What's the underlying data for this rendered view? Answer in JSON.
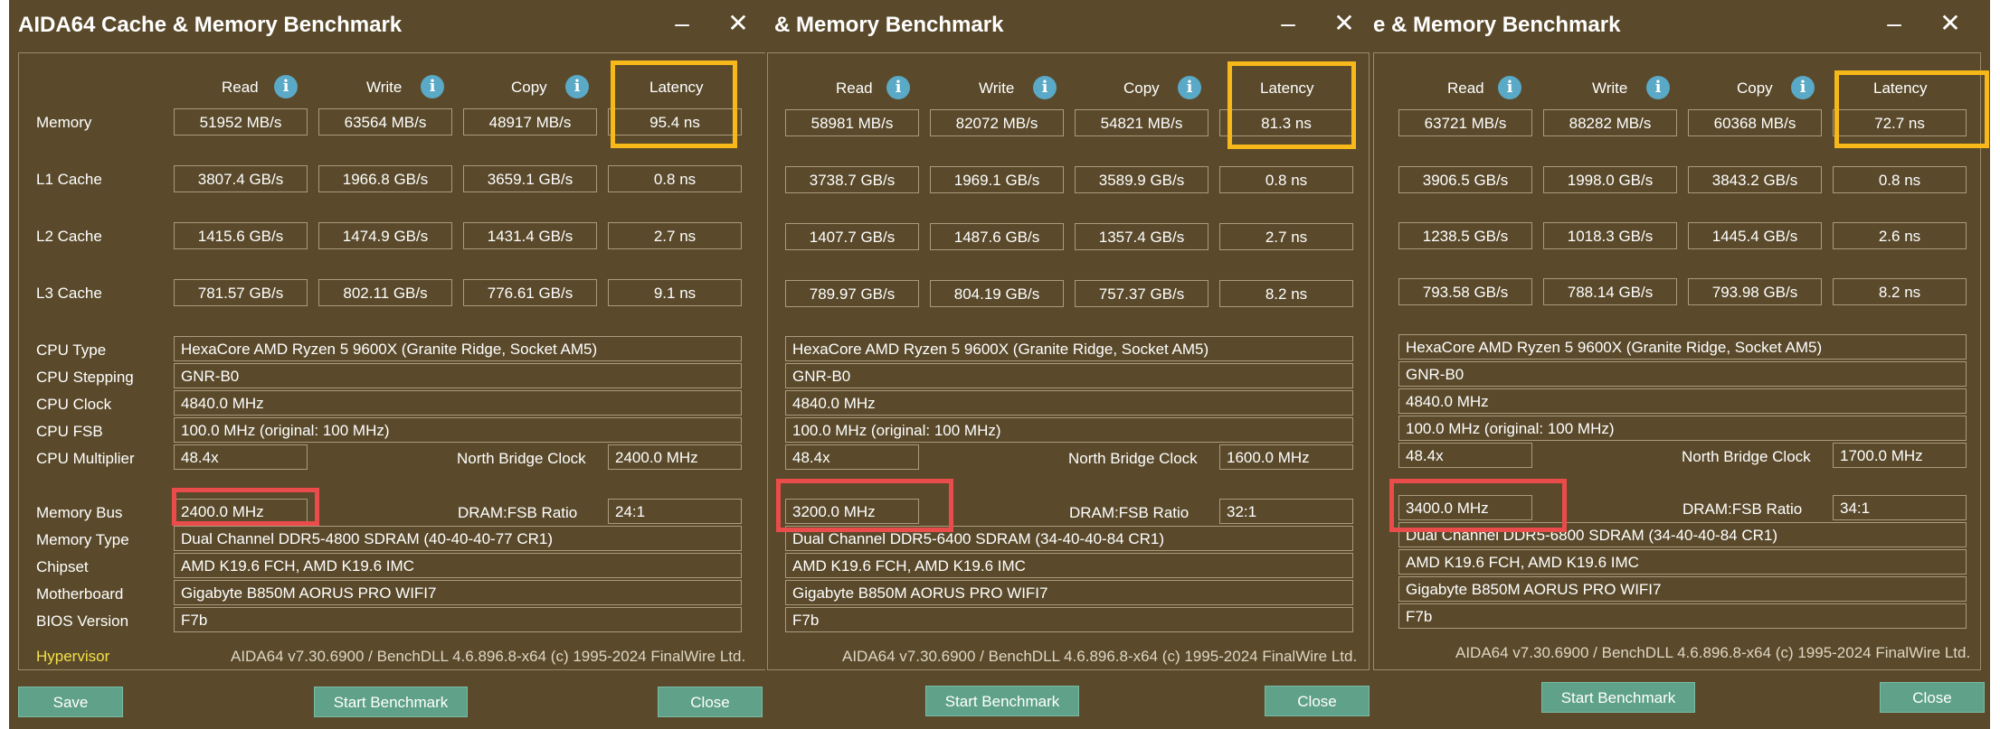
{
  "headers": {
    "read": "Read",
    "write": "Write",
    "copy": "Copy",
    "latency": "Latency"
  },
  "row_labels": {
    "memory": "Memory",
    "l1": "L1 Cache",
    "l2": "L2 Cache",
    "l3": "L3 Cache"
  },
  "info_labels": {
    "cpu_type": "CPU Type",
    "cpu_stepping": "CPU Stepping",
    "cpu_clock": "CPU Clock",
    "cpu_fsb": "CPU FSB",
    "cpu_multiplier": "CPU Multiplier",
    "nb_clock": "North Bridge Clock",
    "memory_bus": "Memory Bus",
    "dram_fsb": "DRAM:FSB Ratio",
    "memory_type": "Memory Type",
    "chipset": "Chipset",
    "motherboard": "Motherboard",
    "bios": "BIOS Version"
  },
  "buttons": {
    "save": "Save",
    "start": "Start Benchmark",
    "close": "Close"
  },
  "hypervisor": "Hypervisor",
  "footer": "AIDA64 v7.30.6900 / BenchDLL 4.6.896.8-x64  (c) 1995-2024 FinalWire Ltd.",
  "icons": {
    "info": "info-icon",
    "minimize": "minimize-icon",
    "close": "close-icon"
  },
  "colors": {
    "background": "#5a4a2b",
    "highlight_latency": "#f7b919",
    "highlight_bus": "#ea4b4b",
    "buttons": "#5fa189",
    "hypervisor": "#f3e04a"
  },
  "windows": [
    {
      "title": "AIDA64 Cache & Memory Benchmark",
      "memory": [
        "51952 MB/s",
        "63564 MB/s",
        "48917 MB/s",
        "95.4 ns"
      ],
      "l1": [
        "3807.4 GB/s",
        "1966.8 GB/s",
        "3659.1 GB/s",
        "0.8 ns"
      ],
      "l2": [
        "1415.6 GB/s",
        "1474.9 GB/s",
        "1431.4 GB/s",
        "2.7 ns"
      ],
      "l3": [
        "781.57 GB/s",
        "802.11 GB/s",
        "776.61 GB/s",
        "9.1 ns"
      ],
      "cpu_type": "HexaCore AMD Ryzen 5 9600X  (Granite Ridge, Socket AM5)",
      "cpu_stepping": "GNR-B0",
      "cpu_clock": "4840.0 MHz",
      "cpu_fsb": "100.0 MHz  (original: 100 MHz)",
      "cpu_multiplier": "48.4x",
      "nb_clock": "2400.0 MHz",
      "memory_bus": "2400.0 MHz",
      "dram_fsb": "24:1",
      "memory_type": "Dual Channel DDR5-4800 SDRAM  (40-40-40-77 CR1)",
      "chipset": "AMD K19.6 FCH, AMD K19.6 IMC",
      "motherboard": "Gigabyte B850M AORUS PRO WIFI7",
      "bios": "F7b"
    },
    {
      "title": "& Memory Benchmark",
      "memory": [
        "58981 MB/s",
        "82072 MB/s",
        "54821 MB/s",
        "81.3 ns"
      ],
      "l1": [
        "3738.7 GB/s",
        "1969.1 GB/s",
        "3589.9 GB/s",
        "0.8 ns"
      ],
      "l2": [
        "1407.7 GB/s",
        "1487.6 GB/s",
        "1357.4 GB/s",
        "2.7 ns"
      ],
      "l3": [
        "789.97 GB/s",
        "804.19 GB/s",
        "757.37 GB/s",
        "8.2 ns"
      ],
      "cpu_type": "HexaCore AMD Ryzen 5 9600X  (Granite Ridge, Socket AM5)",
      "cpu_stepping": "GNR-B0",
      "cpu_clock": "4840.0 MHz",
      "cpu_fsb": "100.0 MHz  (original: 100 MHz)",
      "cpu_multiplier": "48.4x",
      "nb_clock": "1600.0 MHz",
      "memory_bus": "3200.0 MHz",
      "dram_fsb": "32:1",
      "memory_type": "Dual Channel DDR5-6400 SDRAM  (34-40-40-84 CR1)",
      "chipset": "AMD K19.6 FCH, AMD K19.6 IMC",
      "motherboard": "Gigabyte B850M AORUS PRO WIFI7",
      "bios": "F7b"
    },
    {
      "title": "e & Memory Benchmark",
      "memory": [
        "63721 MB/s",
        "88282 MB/s",
        "60368 MB/s",
        "72.7 ns"
      ],
      "l1": [
        "3906.5 GB/s",
        "1998.0 GB/s",
        "3843.2 GB/s",
        "0.8 ns"
      ],
      "l2": [
        "1238.5 GB/s",
        "1018.3 GB/s",
        "1445.4 GB/s",
        "2.6 ns"
      ],
      "l3": [
        "793.58 GB/s",
        "788.14 GB/s",
        "793.98 GB/s",
        "8.2 ns"
      ],
      "cpu_type": "HexaCore AMD Ryzen 5 9600X  (Granite Ridge, Socket AM5)",
      "cpu_stepping": "GNR-B0",
      "cpu_clock": "4840.0 MHz",
      "cpu_fsb": "100.0 MHz  (original: 100 MHz)",
      "cpu_multiplier": "48.4x",
      "nb_clock": "1700.0 MHz",
      "memory_bus": "3400.0 MHz",
      "dram_fsb": "34:1",
      "memory_type": "Dual Channel DDR5-6800 SDRAM  (34-40-40-84 CR1)",
      "chipset": "AMD K19.6 FCH, AMD K19.6 IMC",
      "motherboard": "Gigabyte B850M AORUS PRO WIFI7",
      "bios": "F7b"
    }
  ]
}
